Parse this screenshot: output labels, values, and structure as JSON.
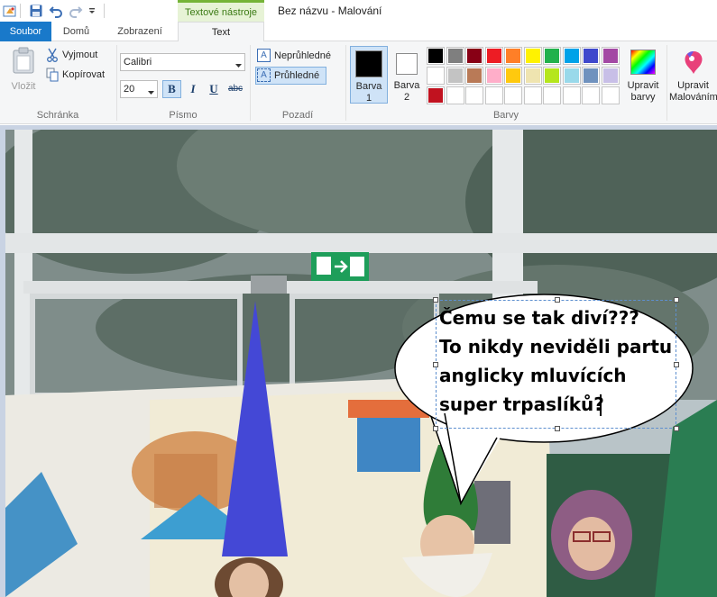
{
  "titlebar": {
    "contextual_tab_group": "Textové nástroje",
    "window_title": "Bez názvu - Malování"
  },
  "tabs": {
    "file": "Soubor",
    "home": "Domů",
    "view": "Zobrazení",
    "text": "Text"
  },
  "clipboard": {
    "paste": "Vložit",
    "cut": "Vyjmout",
    "copy": "Kopírovat",
    "group_label": "Schránka"
  },
  "font": {
    "family": "Calibri",
    "size": "20",
    "bold": "B",
    "italic": "I",
    "underline": "U",
    "strikethrough": "abc",
    "group_label": "Písmo"
  },
  "background": {
    "opaque": "Neprůhledné",
    "transparent": "Průhledné",
    "group_label": "Pozadí"
  },
  "colors": {
    "color1_line1": "Barva",
    "color1_line2": "1",
    "color2_line1": "Barva",
    "color2_line2": "2",
    "edit_colors_line1": "Upravit",
    "edit_colors_line2": "barvy",
    "group_label": "Barvy",
    "color1_value": "#000000",
    "color2_value": "#ffffff",
    "palette_row1": [
      "#000000",
      "#7f7f7f",
      "#880015",
      "#ed1c24",
      "#ff7f27",
      "#fff200",
      "#22b14c",
      "#00a2e8",
      "#3f48cc",
      "#a349a4"
    ],
    "palette_row2": [
      "#ffffff",
      "#c3c3c3",
      "#b97a57",
      "#ffaec9",
      "#ffc90e",
      "#efe4b0",
      "#b5e61d",
      "#99d9ea",
      "#7092be",
      "#c8bfe7"
    ],
    "palette_row3": [
      "#c1121f",
      "",
      "",
      "",
      "",
      "",
      "",
      "",
      "",
      ""
    ]
  },
  "paint3d": {
    "line1": "Upravit",
    "line2": "Malováním"
  },
  "speech_bubble": {
    "line1": "Čemu se tak diví???",
    "line2": "To nikdy neviděli partu",
    "line3": "anglicky mluvících",
    "line4": "super trpaslíků?"
  },
  "accent_color": "#1979ca",
  "contextual_tab_color": "#e7f3d6"
}
